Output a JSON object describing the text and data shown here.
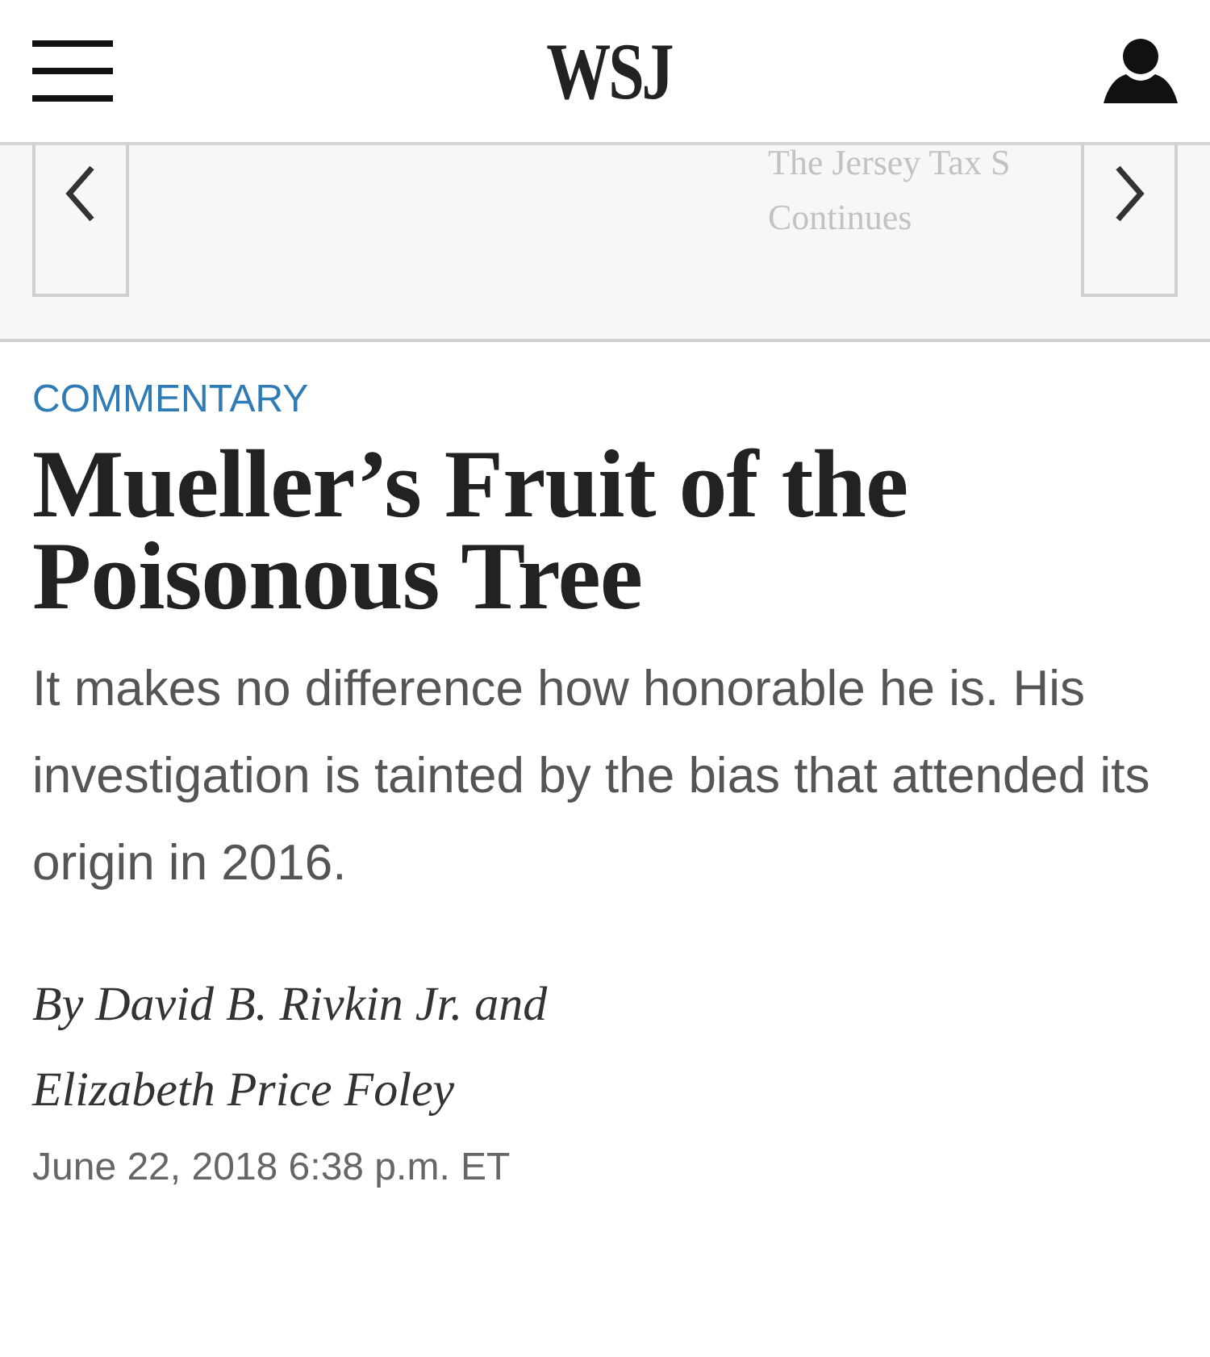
{
  "header": {
    "logo": "WSJ"
  },
  "carousel": {
    "headline": "The Jersey Tax S Continues"
  },
  "article": {
    "section": "COMMENTARY",
    "headline": "Mueller’s Fruit of the Poisonous Tree",
    "dek": "It makes no difference how honorable he is. His investigation is tainted by the bias that attended its origin in 2016.",
    "byline": "By David B. Rivkin Jr. and Elizabeth Price Foley",
    "date": "June 22, 2018 6:38 p.m. ET"
  }
}
